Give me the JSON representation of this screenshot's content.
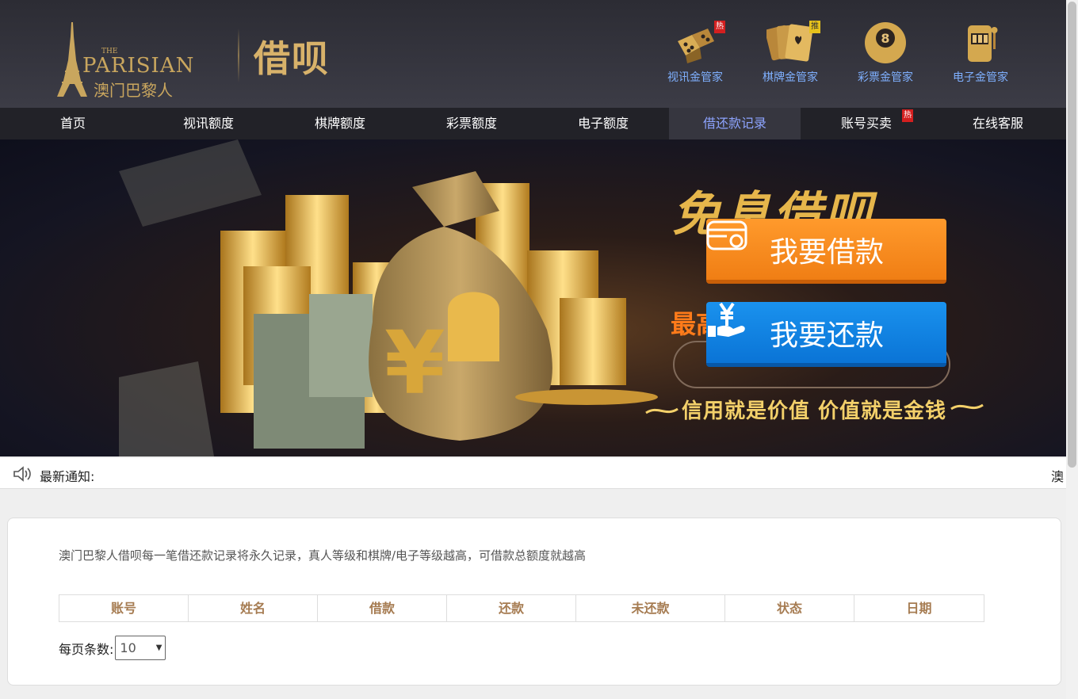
{
  "header": {
    "logo_the": "THE",
    "logo_name": "PARISIAN",
    "logo_cn": "澳门巴黎人",
    "brand": "借呗",
    "managers": [
      {
        "label": "视讯金管家",
        "icon": "dice-icon",
        "tag": "热"
      },
      {
        "label": "棋牌金管家",
        "icon": "playing-cards-icon",
        "tag": "推"
      },
      {
        "label": "彩票金管家",
        "icon": "eight-ball-icon",
        "tag": ""
      },
      {
        "label": "电子金管家",
        "icon": "slot-machine-icon",
        "tag": ""
      }
    ]
  },
  "nav": {
    "items": [
      {
        "label": "首页"
      },
      {
        "label": "视讯额度"
      },
      {
        "label": "棋牌额度"
      },
      {
        "label": "彩票额度"
      },
      {
        "label": "电子额度"
      },
      {
        "label": "借还款记录",
        "active": true
      },
      {
        "label": "账号买卖",
        "tag": "热"
      },
      {
        "label": "在线客服"
      }
    ]
  },
  "banner": {
    "title": "免息借呗",
    "rate": "最高",
    "borrow_label": "我要借款",
    "repay_label": "我要还款",
    "slogan": "信用就是价值 价值就是金钱"
  },
  "notice": {
    "label": "最新通知:",
    "marquee": "澳"
  },
  "content": {
    "description": "澳门巴黎人借呗每一笔借还款记录将永久记录，真人等级和棋牌/电子等级越高，可借款总额度就越高",
    "columns": [
      "账号",
      "姓名",
      "借款",
      "还款",
      "未还款",
      "状态",
      "日期"
    ],
    "page_size_label": "每页条数:",
    "page_size_value": "10"
  },
  "colors": {
    "header_bg": "#34343c",
    "nav_bg": "#222228",
    "nav_active": "#8da4ff",
    "borrow_orange": "#f7891e",
    "repay_blue": "#1182e2",
    "table_header_text": "#a67c52"
  }
}
